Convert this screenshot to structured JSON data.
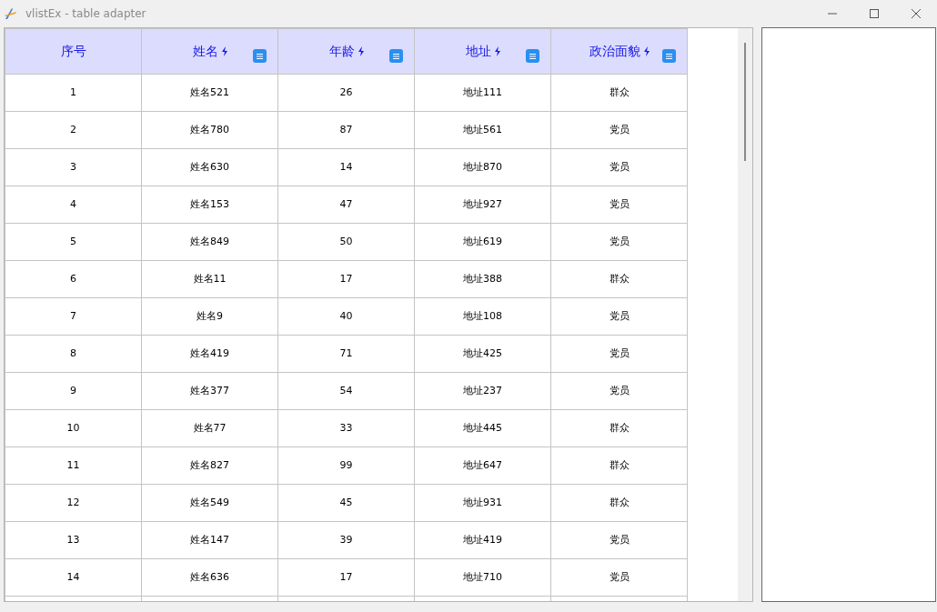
{
  "window": {
    "title": "vlistEx - table adapter"
  },
  "table": {
    "columns": [
      {
        "label": "序号",
        "sortable": false,
        "filter": false
      },
      {
        "label": "姓名",
        "sortable": true,
        "filter": true
      },
      {
        "label": "年龄",
        "sortable": true,
        "filter": true
      },
      {
        "label": "地址",
        "sortable": true,
        "filter": true
      },
      {
        "label": "政治面貌",
        "sortable": true,
        "filter": true
      }
    ],
    "rows": [
      [
        "1",
        "姓名521",
        "26",
        "地址111",
        "群众"
      ],
      [
        "2",
        "姓名780",
        "87",
        "地址561",
        "党员"
      ],
      [
        "3",
        "姓名630",
        "14",
        "地址870",
        "党员"
      ],
      [
        "4",
        "姓名153",
        "47",
        "地址927",
        "党员"
      ],
      [
        "5",
        "姓名849",
        "50",
        "地址619",
        "党员"
      ],
      [
        "6",
        "姓名11",
        "17",
        "地址388",
        "群众"
      ],
      [
        "7",
        "姓名9",
        "40",
        "地址108",
        "党员"
      ],
      [
        "8",
        "姓名419",
        "71",
        "地址425",
        "党员"
      ],
      [
        "9",
        "姓名377",
        "54",
        "地址237",
        "党员"
      ],
      [
        "10",
        "姓名77",
        "33",
        "地址445",
        "群众"
      ],
      [
        "11",
        "姓名827",
        "99",
        "地址647",
        "群众"
      ],
      [
        "12",
        "姓名549",
        "45",
        "地址931",
        "群众"
      ],
      [
        "13",
        "姓名147",
        "39",
        "地址419",
        "党员"
      ],
      [
        "14",
        "姓名636",
        "17",
        "地址710",
        "党员"
      ]
    ]
  }
}
